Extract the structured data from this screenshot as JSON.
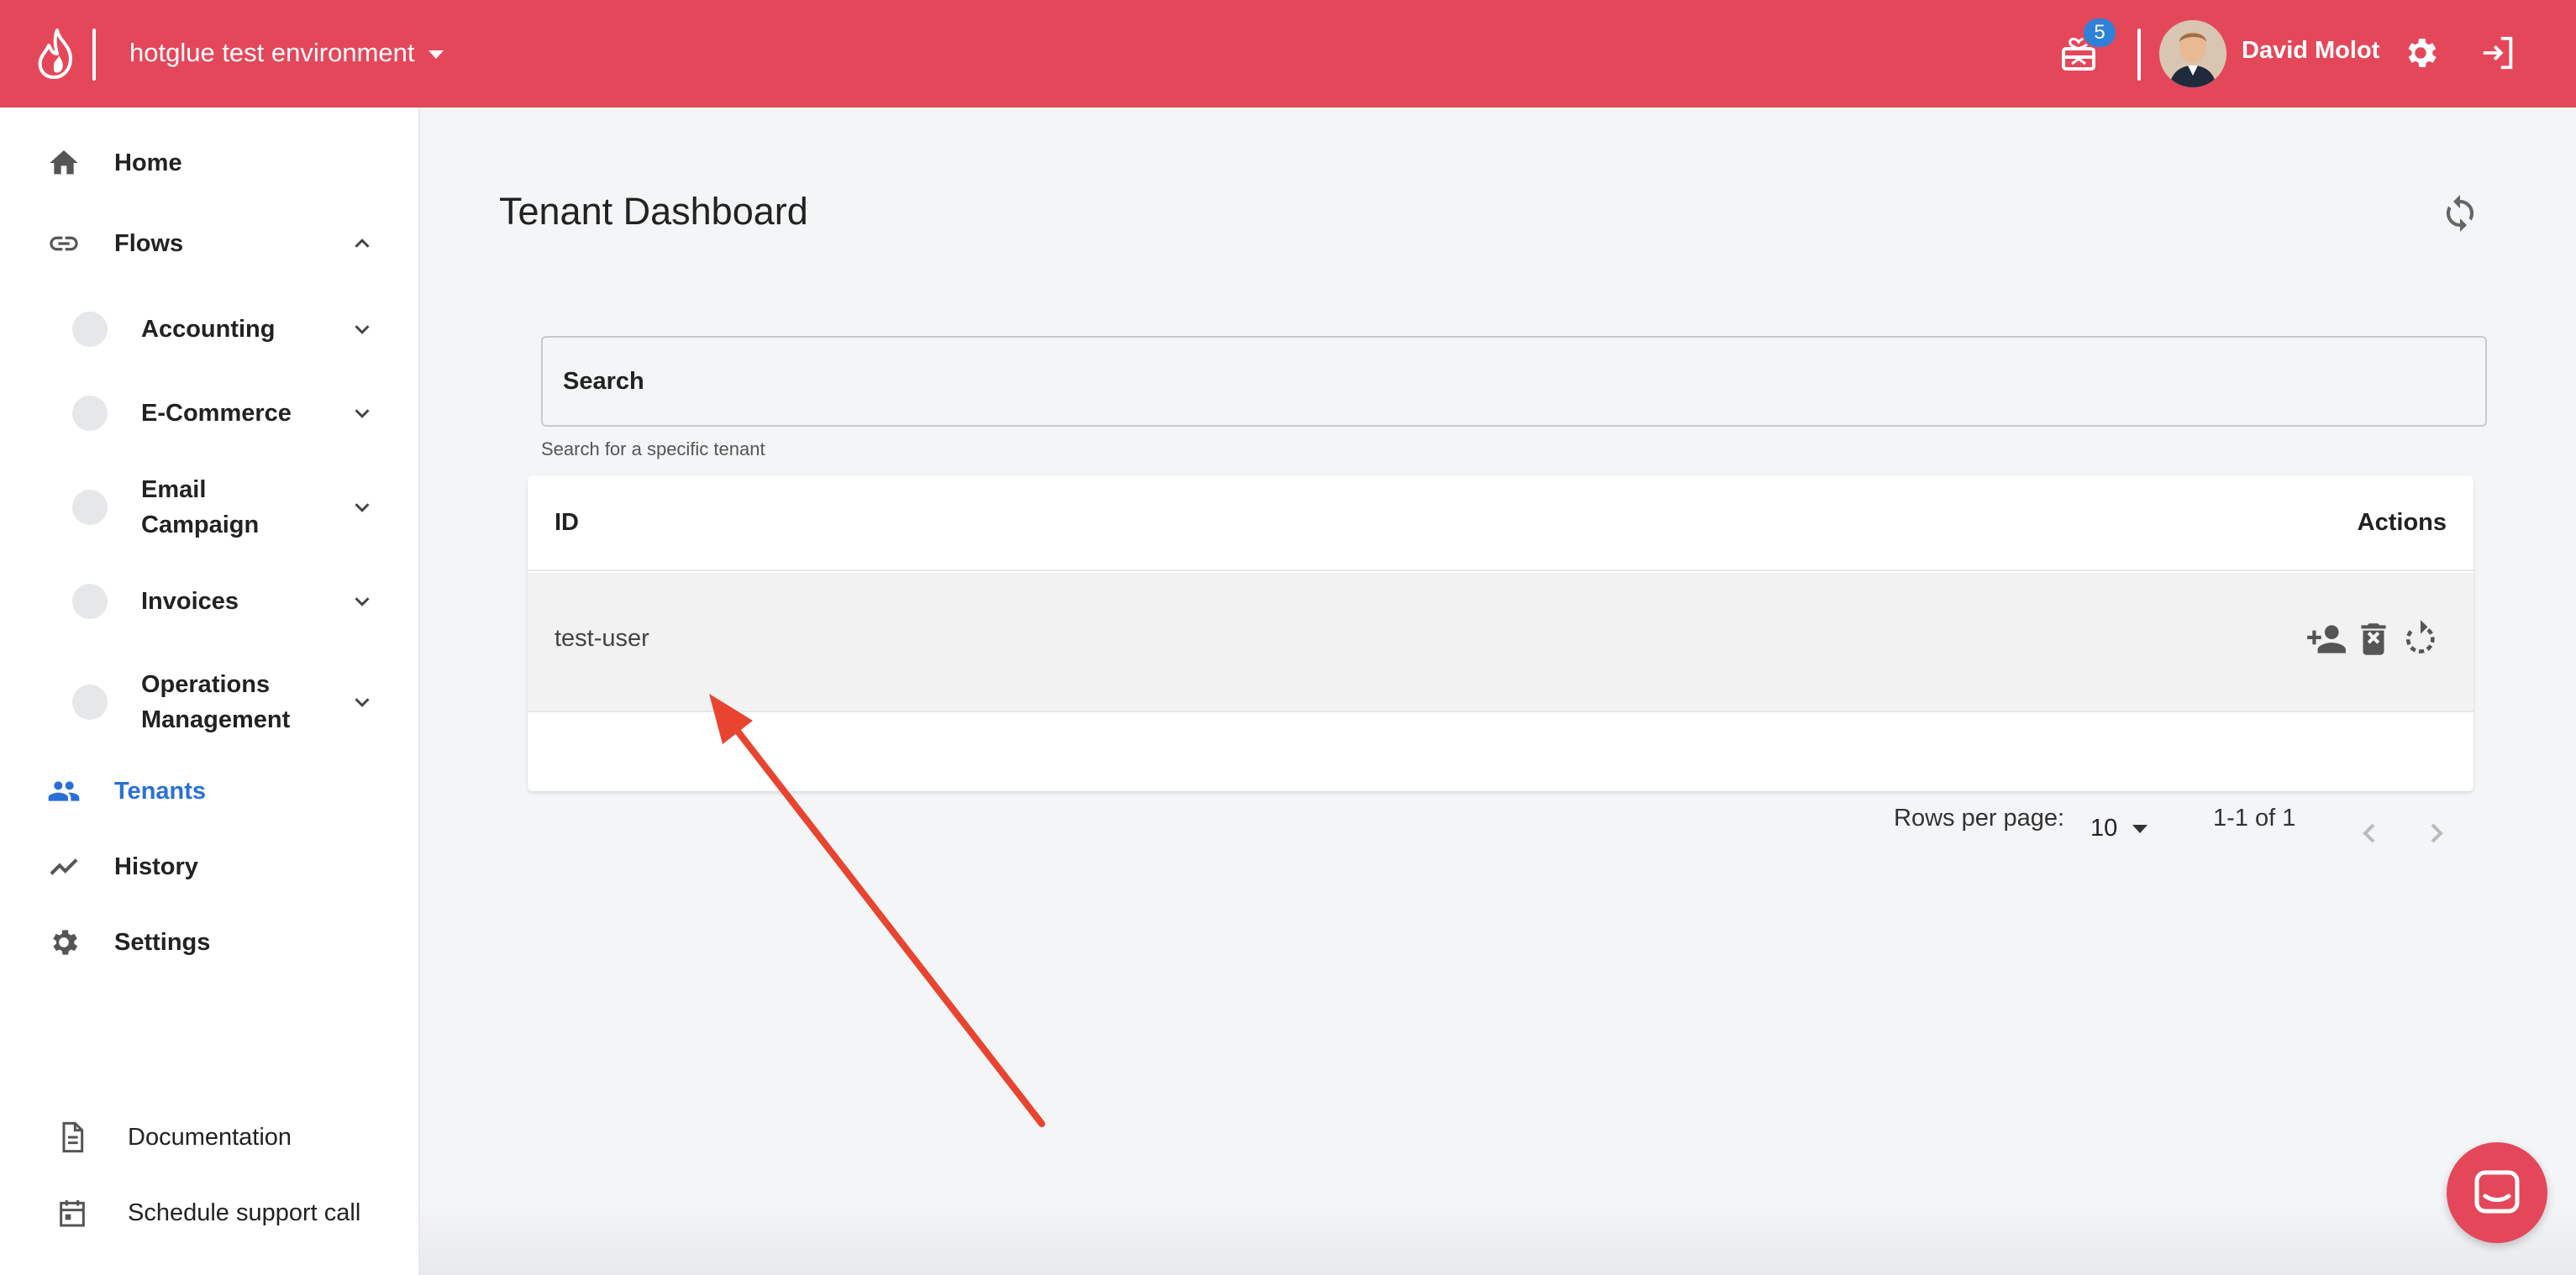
{
  "header": {
    "environment": "hotglue test environment",
    "notifications_count": "5",
    "user_name": "David Molot"
  },
  "sidebar": {
    "items": [
      {
        "label": "Home",
        "icon": "home-icon"
      },
      {
        "label": "Flows",
        "icon": "link-icon"
      },
      {
        "label": "Tenants",
        "icon": "people-icon",
        "active": true
      },
      {
        "label": "History",
        "icon": "trending-icon"
      },
      {
        "label": "Settings",
        "icon": "gear-icon"
      }
    ],
    "flows": [
      {
        "label": "Accounting"
      },
      {
        "label": "E-Commerce"
      },
      {
        "label": "Email",
        "label2": "Campaign"
      },
      {
        "label": "Invoices"
      },
      {
        "label": "Operations",
        "label2": "Management"
      }
    ],
    "footer": {
      "documentation": "Documentation",
      "support": "Schedule support call"
    }
  },
  "main": {
    "title": "Tenant Dashboard",
    "search": {
      "placeholder": "Search",
      "helper": "Search for a specific tenant"
    },
    "table": {
      "headers": {
        "id": "ID",
        "actions": "Actions"
      },
      "rows": [
        {
          "id": "test-user"
        }
      ]
    },
    "pagination": {
      "rows_per_page_label": "Rows per page:",
      "rows_per_page": "10",
      "range": "1-1 of 1"
    }
  },
  "colors": {
    "brand": "#e5475a",
    "active": "#2b6fd6",
    "badge": "#2f80d9",
    "annotation_arrow": "#e8442f"
  }
}
